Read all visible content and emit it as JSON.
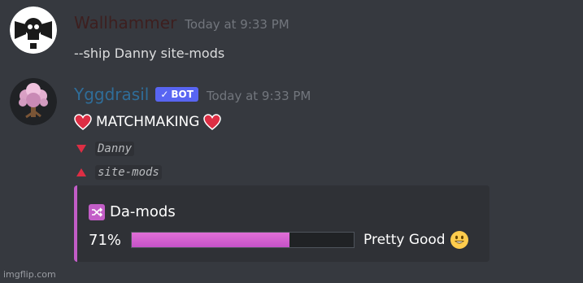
{
  "messages": [
    {
      "username": "Wallhammer",
      "username_color": "#3d1f1f",
      "timestamp": "Today at 9:33 PM",
      "text": "--ship Danny site-mods"
    },
    {
      "username": "Yggdrasil",
      "username_color": "#2f6d99",
      "bot_tag": "BOT",
      "timestamp": "Today at 9:33 PM",
      "title": "MATCHMAKING",
      "lines": [
        {
          "icon": "red-triangle-down-icon",
          "value": "Danny"
        },
        {
          "icon": "red-triangle-up-icon",
          "value": "site-mods"
        }
      ],
      "embed": {
        "accent_color": "#c25dc7",
        "title": "Da-mods",
        "percent_label": "71%",
        "percent_value": 0.71,
        "verdict": "Pretty Good"
      }
    }
  ],
  "watermark": "imgflip.com"
}
